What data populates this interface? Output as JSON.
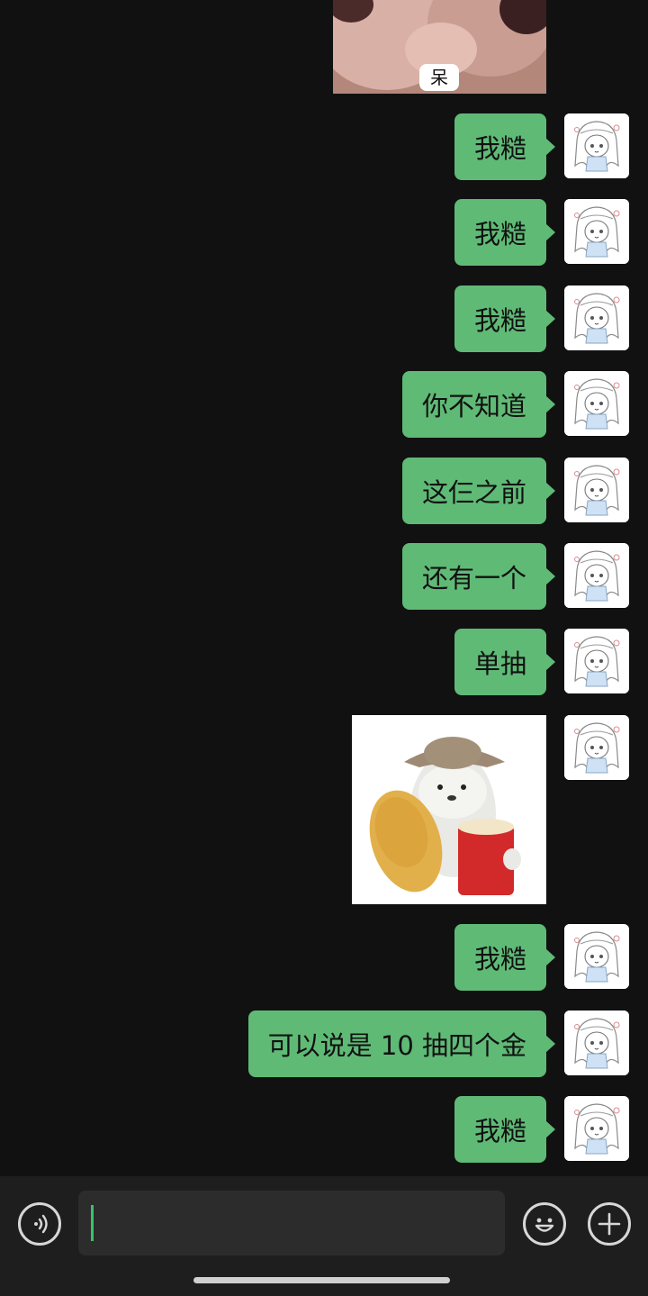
{
  "messages": [
    {
      "type": "text",
      "text": "我糙"
    },
    {
      "type": "text",
      "text": "我糙"
    },
    {
      "type": "text",
      "text": "我糙"
    },
    {
      "type": "text",
      "text": "你不知道"
    },
    {
      "type": "text",
      "text": "这仨之前"
    },
    {
      "type": "text",
      "text": "还有一个"
    },
    {
      "type": "text",
      "text": "单抽"
    },
    {
      "type": "image",
      "sticker": "cat-cowboy-hat-chips-soda-sticker"
    },
    {
      "type": "text",
      "text": "我糙"
    },
    {
      "type": "text",
      "text": "可以说是 10 抽四个金"
    },
    {
      "type": "text",
      "text": "我糙"
    }
  ],
  "top_image": {
    "caption": "呆",
    "sticker": "closeup-face-sticker"
  },
  "avatar": "anime-girl-sketch-avatar",
  "input_bar": {
    "voice_icon": "voice-icon",
    "emoji_icon": "emoji-icon",
    "more_icon": "plus-icon",
    "value": ""
  },
  "colors": {
    "background": "#111111",
    "bubble": "#5fba76",
    "input_bar": "#1e1e1e",
    "caret": "#38c26a"
  }
}
